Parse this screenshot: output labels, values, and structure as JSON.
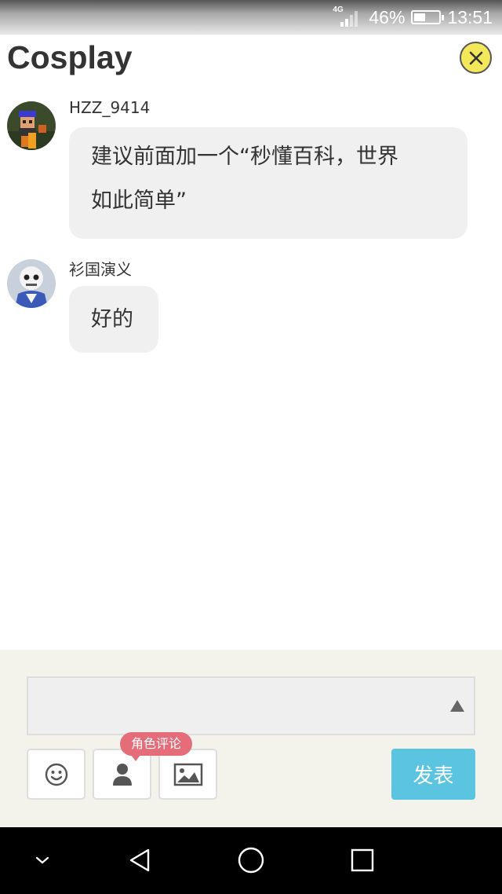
{
  "status_bar": {
    "network": "4G",
    "battery_percent": "46%",
    "battery_level": 0.46,
    "time": "13:51"
  },
  "header": {
    "title": "Cosplay",
    "close_icon": "close-icon"
  },
  "messages": [
    {
      "username": "HZZ_9414",
      "lines": [
        "建议前面加一个“秒懂百科，世界",
        "如此简单”"
      ],
      "avatar": "pixel-character-avatar"
    },
    {
      "username": "衫国演义",
      "lines": [
        "好的"
      ],
      "avatar": "skeleton-character-avatar"
    }
  ],
  "composer": {
    "input_value": "",
    "emoji_icon": "smiley-icon",
    "role_icon": "person-icon",
    "image_icon": "image-icon",
    "role_tag": "角色评论",
    "send_label": "发表",
    "accent_color": "#5bc4e0",
    "tag_color": "#e46d79"
  },
  "nav": [
    "hide-keyboard-icon",
    "back-icon",
    "home-icon",
    "recents-icon"
  ]
}
